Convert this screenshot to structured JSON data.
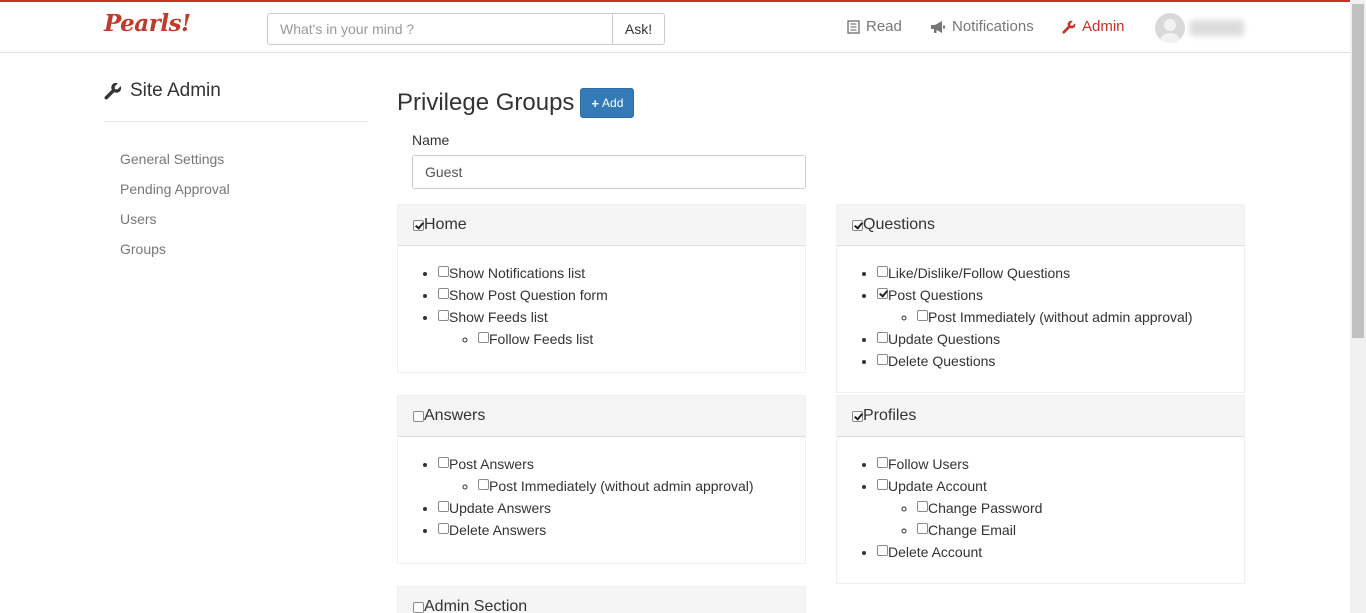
{
  "colors": {
    "brand": "#c9302c",
    "primary": "#337ab7",
    "muted": "#777777"
  },
  "navbar": {
    "brand": "Pearls!",
    "search_placeholder": "What's in your mind ?",
    "ask_label": "Ask!",
    "links": [
      {
        "label": "Read",
        "icon": "book-icon",
        "active": false
      },
      {
        "label": "Notifications",
        "icon": "megaphone-icon",
        "active": false
      },
      {
        "label": "Admin",
        "icon": "wrench-icon",
        "active": true
      }
    ],
    "user": {
      "avatar": "avatar-placeholder"
    }
  },
  "sidebar": {
    "title": "Site Admin",
    "items": [
      {
        "label": "General Settings"
      },
      {
        "label": "Pending Approval"
      },
      {
        "label": "Users"
      },
      {
        "label": "Groups"
      }
    ]
  },
  "main": {
    "title": "Privilege Groups",
    "add_label": "Add",
    "name_label": "Name",
    "name_value": "Guest"
  },
  "panels": {
    "home": {
      "title": "Home",
      "checked": true,
      "items": [
        {
          "label": "Show Notifications list",
          "checked": false
        },
        {
          "label": "Show Post Question form",
          "checked": false
        },
        {
          "label": "Show Feeds list",
          "checked": false
        },
        {
          "label": "Follow Feeds list",
          "checked": false
        }
      ]
    },
    "questions": {
      "title": "Questions",
      "checked": true,
      "items": [
        {
          "label": "Like/Dislike/Follow Questions",
          "checked": false
        },
        {
          "label": "Post Questions",
          "checked": true
        },
        {
          "label": "Post Immediately (without admin approval)",
          "checked": false
        },
        {
          "label": "Update Questions",
          "checked": false
        },
        {
          "label": "Delete Questions",
          "checked": false
        }
      ]
    },
    "answers": {
      "title": "Answers",
      "checked": false,
      "items": [
        {
          "label": "Post Answers",
          "checked": false
        },
        {
          "label": "Post Immediately (without admin approval)",
          "checked": false
        },
        {
          "label": "Update Answers",
          "checked": false
        },
        {
          "label": "Delete Answers",
          "checked": false
        }
      ]
    },
    "profiles": {
      "title": "Profiles",
      "checked": true,
      "items": [
        {
          "label": "Follow Users",
          "checked": false
        },
        {
          "label": "Update Account",
          "checked": false
        },
        {
          "label": "Change Password",
          "checked": false
        },
        {
          "label": "Change Email",
          "checked": false
        },
        {
          "label": "Delete Account",
          "checked": false
        }
      ]
    },
    "admin": {
      "title": "Admin Section",
      "checked": false
    }
  }
}
